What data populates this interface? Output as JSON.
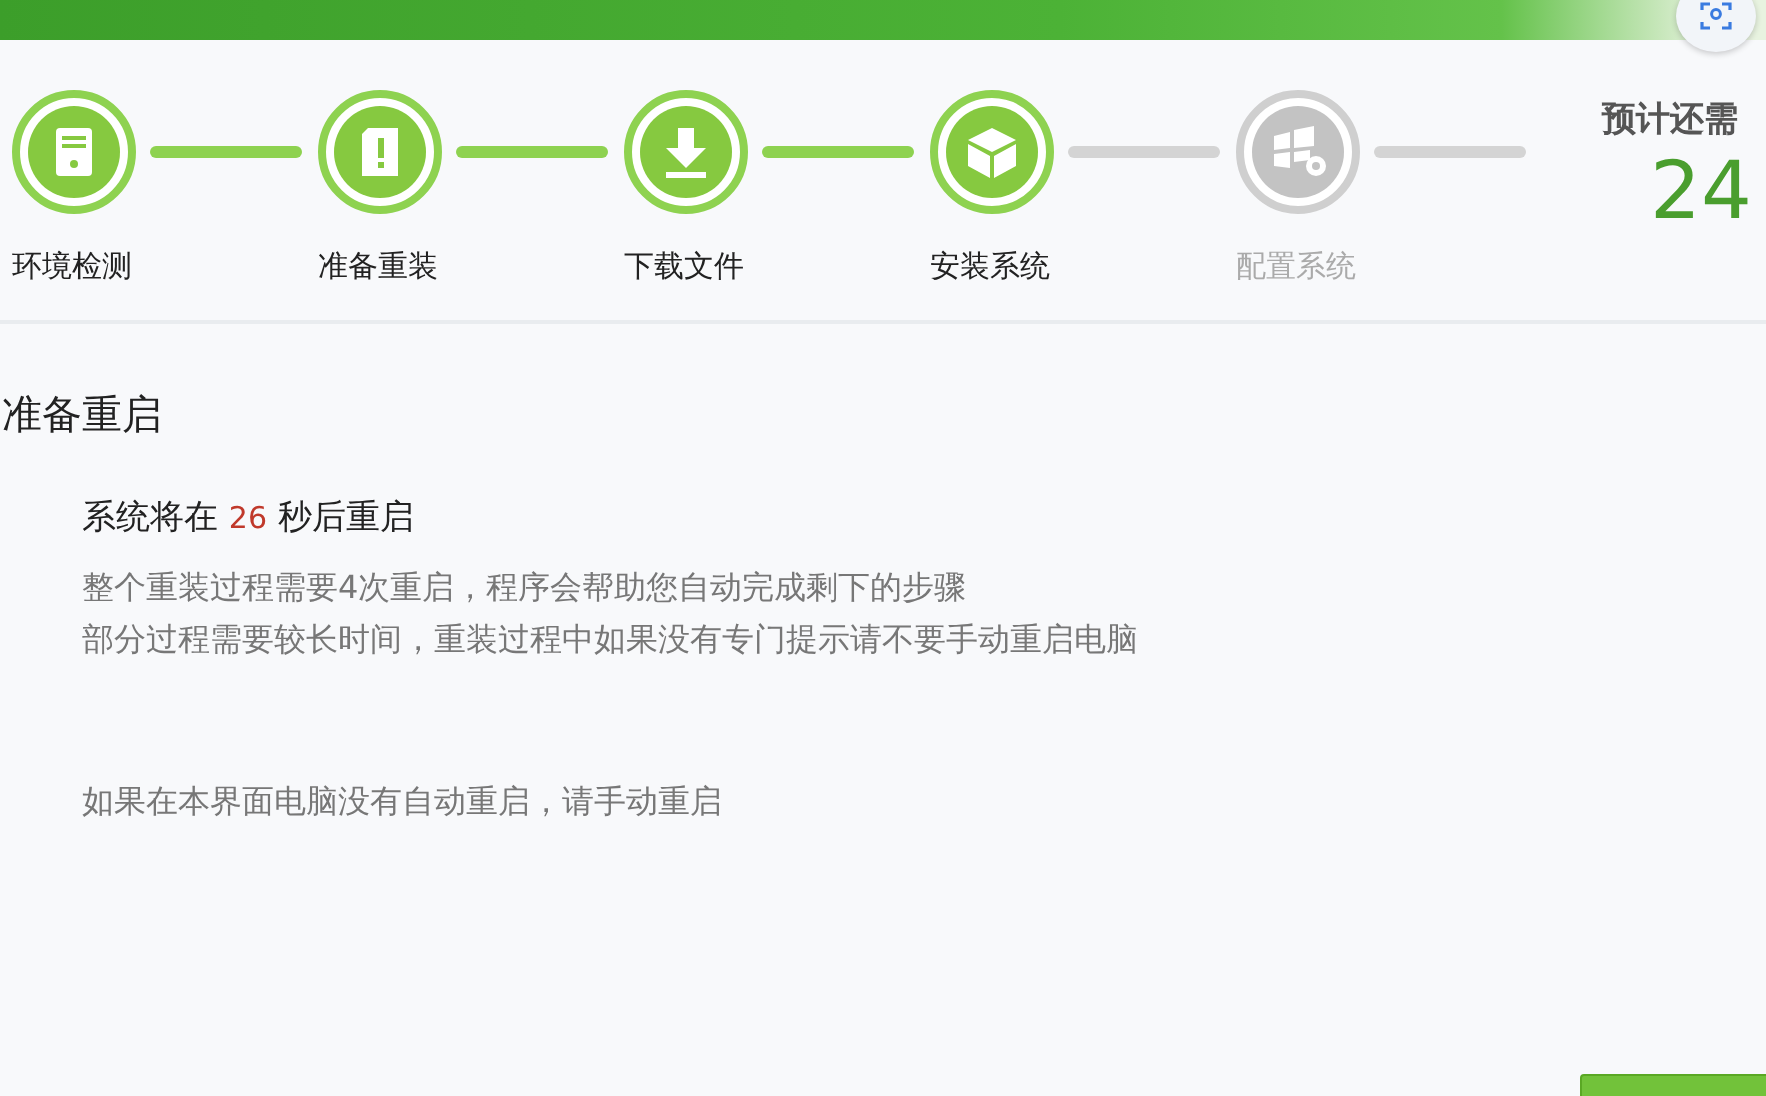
{
  "steps": [
    {
      "label": "环境检测",
      "done": true
    },
    {
      "label": "准备重装",
      "done": true
    },
    {
      "label": "下载文件",
      "done": true
    },
    {
      "label": "安装系统",
      "done": true
    },
    {
      "label": "配置系统",
      "done": false
    }
  ],
  "remaining": {
    "label": "预计还需",
    "value": "24"
  },
  "section_title": "准备重启",
  "countdown": {
    "before": "系统将在",
    "seconds": "26",
    "after": "秒后重启"
  },
  "notes": [
    "整个重装过程需要4次重启，程序会帮助您自动完成剩下的步骤",
    "部分过程需要较长时间，重装过程中如果没有专门提示请不要手动重启电脑"
  ],
  "manual_note": "如果在本界面电脑没有自动重启，请手动重启"
}
